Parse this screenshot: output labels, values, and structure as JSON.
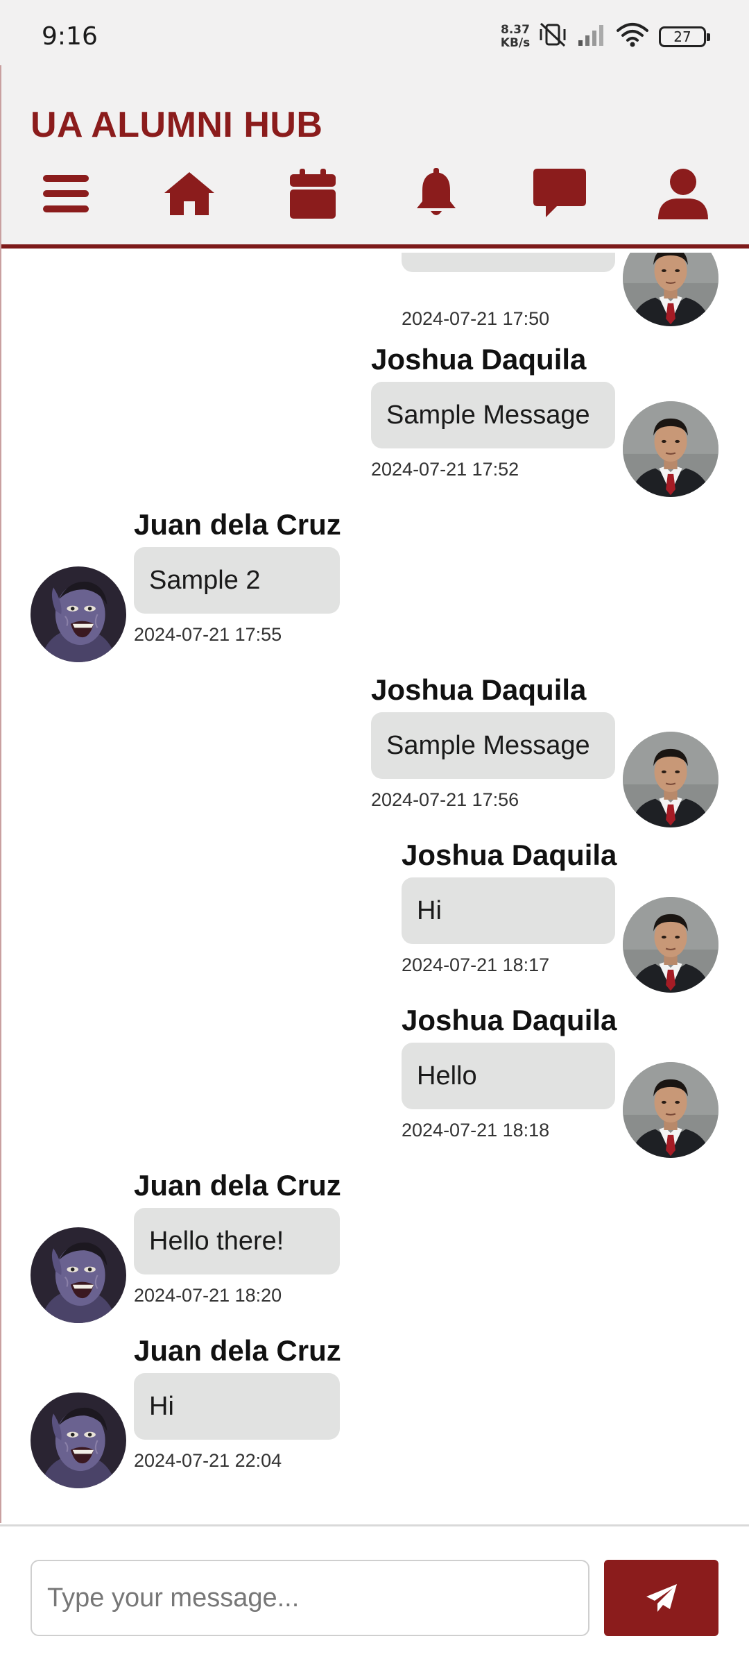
{
  "status_bar": {
    "time": "9:16",
    "net_speed_value": "8.37",
    "net_speed_unit": "KB/s",
    "battery": "27",
    "icons": [
      "vibrate-off-icon",
      "signal-icon",
      "wifi-icon",
      "battery-icon"
    ]
  },
  "header": {
    "title": "UA ALUMNI HUB",
    "nav_icons": [
      "menu-icon",
      "home-icon",
      "calendar-icon",
      "bell-icon",
      "chat-icon",
      "user-icon"
    ]
  },
  "colors": {
    "brand": "#8b1c1c",
    "bubble": "#e1e2e1",
    "header_bg": "#f2f1f1"
  },
  "messages": [
    {
      "sender": "",
      "text": "",
      "timestamp": "2024-07-21 17:50",
      "side": "right"
    },
    {
      "sender": "Joshua Daquila",
      "text": "Sample Message",
      "timestamp": "2024-07-21 17:52",
      "side": "right"
    },
    {
      "sender": "Juan dela Cruz",
      "text": "Sample 2",
      "timestamp": "2024-07-21 17:55",
      "side": "left"
    },
    {
      "sender": "Joshua Daquila",
      "text": "Sample Message",
      "timestamp": "2024-07-21 17:56",
      "side": "right"
    },
    {
      "sender": "Joshua Daquila",
      "text": "Hi",
      "timestamp": "2024-07-21 18:17",
      "side": "right"
    },
    {
      "sender": "Joshua Daquila",
      "text": "Hello",
      "timestamp": "2024-07-21 18:18",
      "side": "right"
    },
    {
      "sender": "Juan dela Cruz",
      "text": "Hello there!",
      "timestamp": "2024-07-21 18:20",
      "side": "left"
    },
    {
      "sender": "Juan dela Cruz",
      "text": "Hi",
      "timestamp": "2024-07-21 22:04",
      "side": "left"
    }
  ],
  "composer": {
    "placeholder": "Type your message...",
    "value": "",
    "send_icon": "send-icon"
  }
}
